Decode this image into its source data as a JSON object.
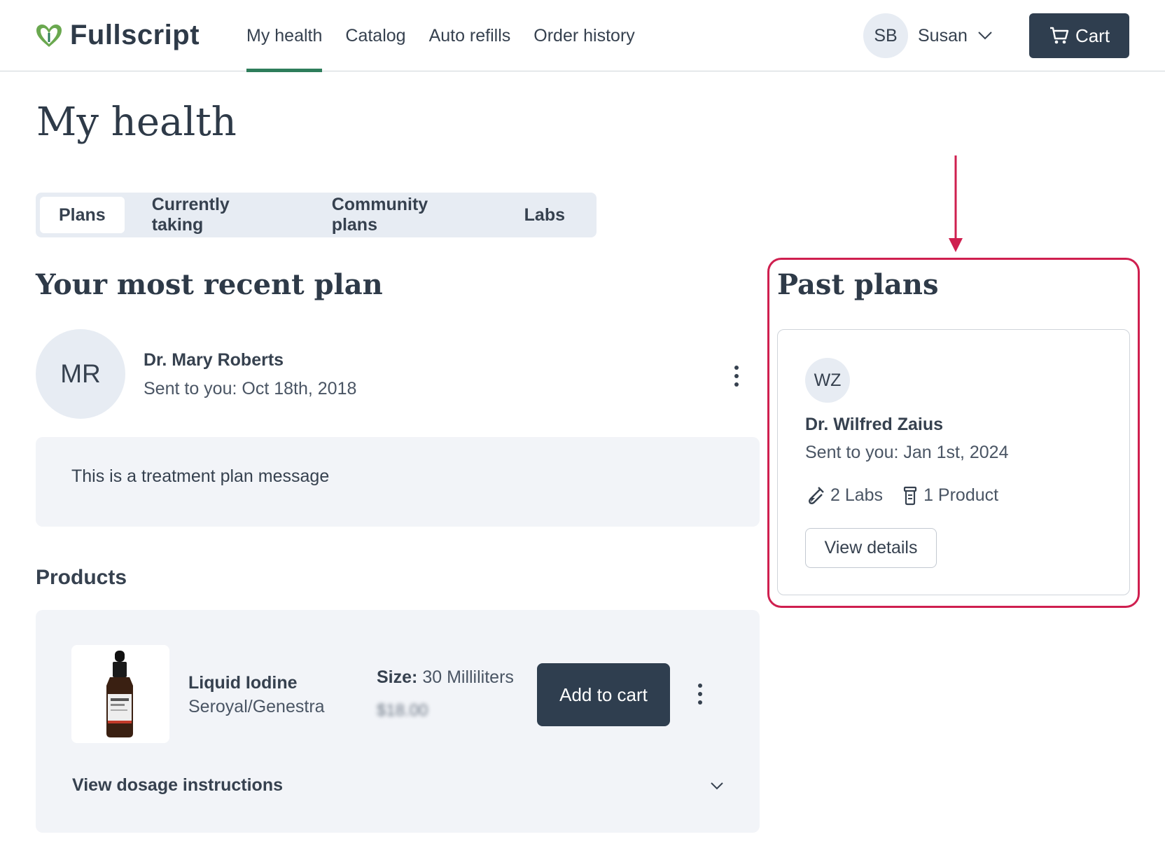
{
  "header": {
    "logo_text": "Fullscript",
    "nav": [
      {
        "label": "My health",
        "active": true
      },
      {
        "label": "Catalog",
        "active": false
      },
      {
        "label": "Auto refills",
        "active": false
      },
      {
        "label": "Order history",
        "active": false
      }
    ],
    "user": {
      "initials": "SB",
      "name": "Susan"
    },
    "cart_label": "Cart"
  },
  "page": {
    "title": "My health",
    "tabs": [
      {
        "label": "Plans",
        "active": true
      },
      {
        "label": "Currently taking",
        "active": false
      },
      {
        "label": "Community plans",
        "active": false
      },
      {
        "label": "Labs",
        "active": false
      }
    ]
  },
  "recent_plan": {
    "section_title": "Your most recent plan",
    "avatar_initials": "MR",
    "doctor": "Dr. Mary Roberts",
    "sent": "Sent to you: Oct 18th, 2018",
    "message": "This is a treatment plan message"
  },
  "products": {
    "title": "Products",
    "items": [
      {
        "name": "Liquid Iodine",
        "brand": "Seroyal/Genestra",
        "size_label": "Size:",
        "size_value": "30 Milliliters",
        "price": "$18.00",
        "add_label": "Add to cart"
      }
    ],
    "dosage_label": "View dosage instructions"
  },
  "past_plans": {
    "title": "Past plans",
    "card": {
      "avatar_initials": "WZ",
      "doctor": "Dr. Wilfred Zaius",
      "sent": "Sent to you: Jan 1st, 2024",
      "labs": "2 Labs",
      "products": "1 Product",
      "button": "View details"
    }
  },
  "colors": {
    "accent_green": "#2e7d5b",
    "button_dark": "#2f3e4f",
    "highlight": "#cf1f4f",
    "panel_bg": "#f2f4f8"
  },
  "icons": {
    "logo": "leaf-heart-icon",
    "user_menu": "chevron-down-icon",
    "cart": "cart-icon",
    "options": "more-vertical-icon",
    "labs": "test-tube-icon",
    "product": "bottle-icon",
    "dosage": "chevron-down-icon"
  }
}
